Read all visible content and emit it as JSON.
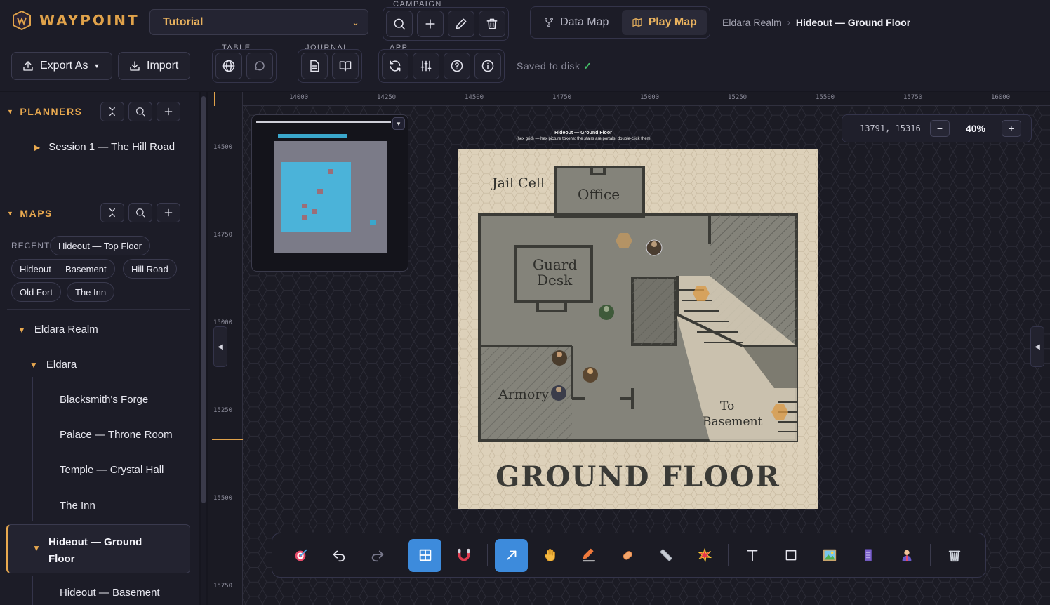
{
  "app": {
    "name": "WAYPOINT",
    "accent": "#e0a24a"
  },
  "campaign": {
    "label": "CAMPAIGN",
    "value": "Tutorial"
  },
  "groups": {
    "table": "TABLE",
    "journal": "JOURNAL",
    "app": "APP"
  },
  "modes": {
    "data_map": "Data Map",
    "play_map": "Play Map",
    "active": "play_map"
  },
  "breadcrumb": {
    "realm": "Eldara Realm",
    "current": "Hideout — Ground Floor"
  },
  "actions": {
    "export": "Export As",
    "import": "Import"
  },
  "status": {
    "saved": "Saved to disk",
    "check": "✓"
  },
  "sidebar": {
    "planners": {
      "title": "PLANNERS",
      "items": [
        {
          "label": "Session 1 — The Hill Road"
        }
      ]
    },
    "maps": {
      "title": "MAPS",
      "recent_label": "RECENT",
      "recent": [
        "Hideout — Top Floor",
        "Hideout — Basement",
        "Hill Road",
        "Old Fort",
        "The Inn"
      ],
      "tree": {
        "realm": "Eldara Realm",
        "region": "Eldara",
        "children": [
          "Blacksmith's Forge",
          "Palace — Throne Room",
          "Temple — Crystal Hall",
          "The Inn"
        ],
        "selected": "Hideout — Ground Floor",
        "selected_children": [
          "Hideout — Basement"
        ]
      }
    }
  },
  "canvas": {
    "ruler_x": [
      "14000",
      "14250",
      "14500",
      "14750",
      "15000",
      "15250",
      "15500",
      "15750",
      "16000"
    ],
    "ruler_y": [
      "14500",
      "14750",
      "15000",
      "15250",
      "15500",
      "15750"
    ],
    "coords": "13791, 15316",
    "zoom": "40%",
    "zoom_minus": "−",
    "zoom_plus": "+",
    "map_title": "Hideout — Ground Floor",
    "map_subtitle": "(hex grid) — hex picture tokens; the stairs are portals: double-click them",
    "rooms": {
      "jail": "Jail Cell",
      "office": "Office",
      "guard1": "Guard",
      "guard2": "Desk",
      "armory": "Armory",
      "basement1": "To",
      "basement2": "Basement"
    },
    "floor_title": "GROUND FLOOR"
  },
  "toolbar": {
    "icons": [
      "target-icon",
      "undo-icon",
      "redo-icon",
      "grid-icon",
      "magnet-icon",
      "select-arrow-icon",
      "hand-icon",
      "pencil-icon",
      "eraser-icon",
      "ruler-icon",
      "burst-icon",
      "text-icon",
      "rectangle-icon",
      "image-icon",
      "door-icon",
      "token-icon",
      "trash-icon"
    ]
  }
}
